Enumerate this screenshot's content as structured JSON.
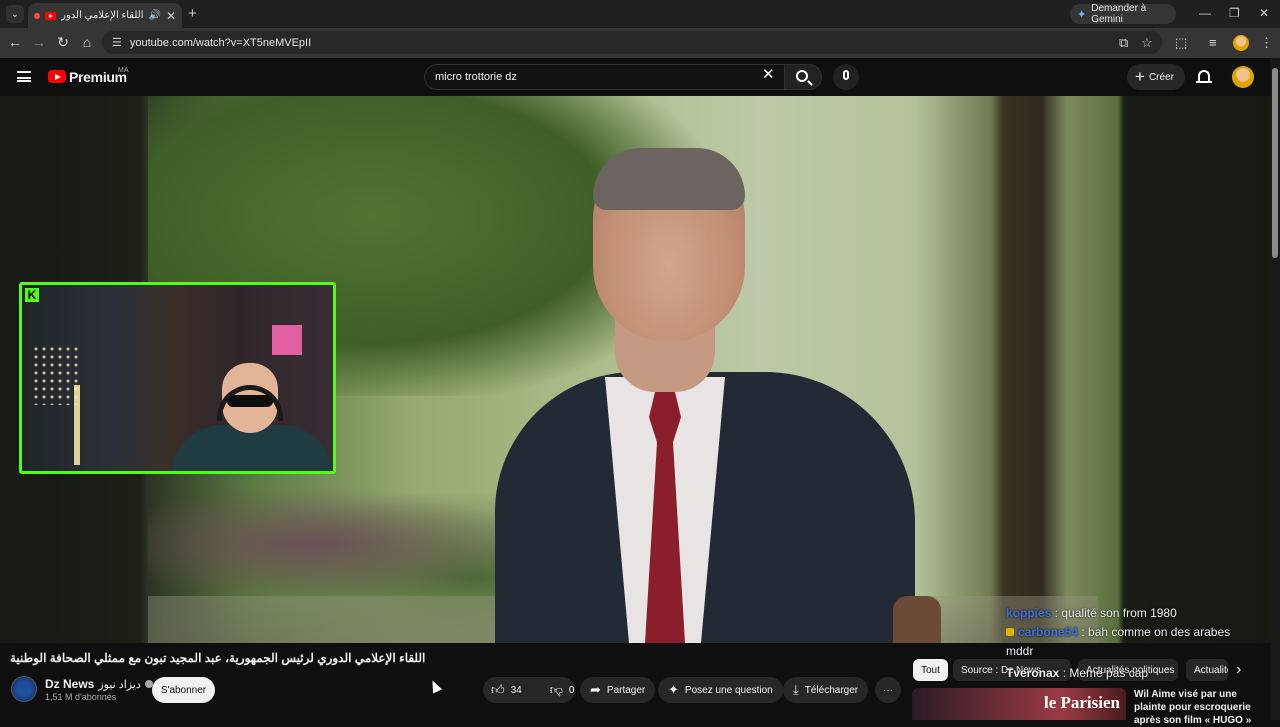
{
  "browser": {
    "tab_title": "اللقاء الإعلامي الدوري لرئيس",
    "url": "youtube.com/watch?v=XT5neMVEpII",
    "gemini_label": "Demander à Gemini"
  },
  "youtube": {
    "brand": "Premium",
    "country": "MA",
    "search_value": "micro trottorie dz",
    "create_label": "Créer"
  },
  "video": {
    "title": "اللقاء الإعلامي الدوري لرئيس الجمهورية، عبد المجيد تبون مع ممثلي الصحافة الوطنية",
    "channel_name": "Dz News",
    "channel_name_ar": "ديزاد نيوز",
    "subscribers": "1,51 M d'abonnés",
    "subscribe_label": "S'abonner",
    "likes": "34",
    "dislikes": "0",
    "share_label": "Partager",
    "ask_label": "Posez une question",
    "download_label": "Télécharger",
    "more_label": "···"
  },
  "chat": [
    {
      "user": "koppies",
      "message": "qualité son from 1980",
      "color": "#3b6fe0"
    },
    {
      "user": "carbone54",
      "message": "bah comme on des arabes mddr",
      "color": "#3b6fe0"
    },
    {
      "user": "Tveronax",
      "message": "Meme pas cap",
      "color": "#ffffff"
    }
  ],
  "chips": [
    "Tout",
    "Source : Dz News",
    "Actualités politiques",
    "Actualités"
  ],
  "recommendation": {
    "thumb_brand": "le Parisien",
    "title": "Wil Aime visé par une plainte pour escroquerie après son film « HUGO »"
  },
  "webcam": {
    "platform_logo": "K"
  }
}
